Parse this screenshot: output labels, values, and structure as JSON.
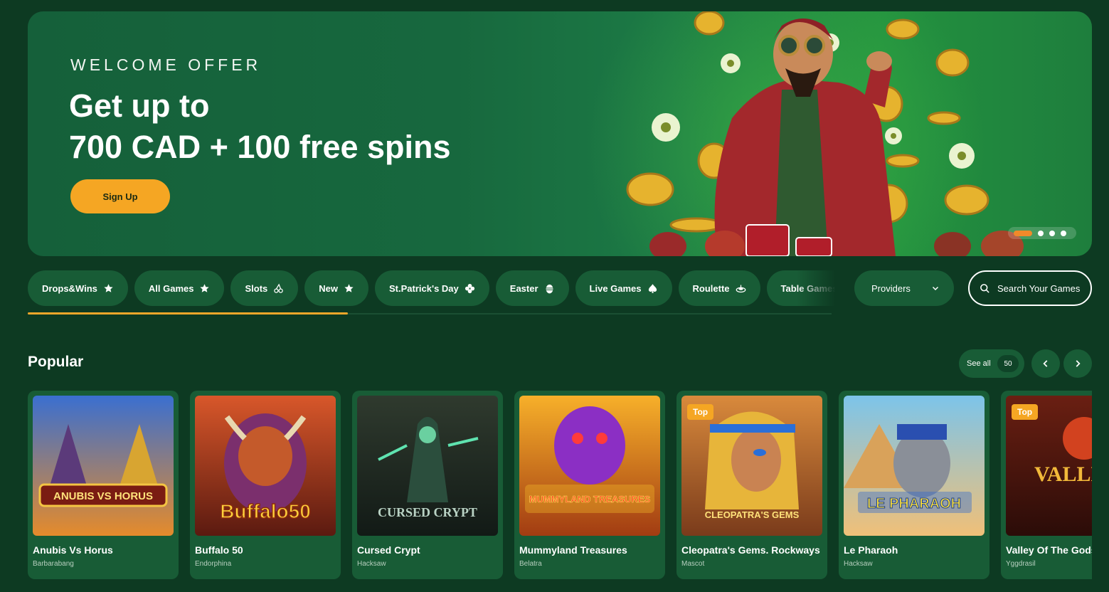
{
  "hero": {
    "kicker": "WELCOME OFFER",
    "title_line1": "Get up to",
    "title_line2": "700 CAD + 100 free spins",
    "cta": "Sign Up",
    "slides_total": 4,
    "active_slide": 1
  },
  "categories": [
    {
      "label": "Drops&Wins",
      "icon": "star-icon"
    },
    {
      "label": "All Games",
      "icon": "star-icon"
    },
    {
      "label": "Slots",
      "icon": "cherry-icon"
    },
    {
      "label": "New",
      "icon": "star-icon"
    },
    {
      "label": "St.Patrick's Day",
      "icon": "clover-icon"
    },
    {
      "label": "Easter",
      "icon": "egg-icon"
    },
    {
      "label": "Live Games",
      "icon": "spade-icon"
    },
    {
      "label": "Roulette",
      "icon": "roulette-icon"
    },
    {
      "label": "Table Games",
      "icon": "cards-icon"
    }
  ],
  "providers": {
    "label": "Providers"
  },
  "search": {
    "label": "Search Your Games"
  },
  "popular": {
    "title": "Popular",
    "see_all": "See all",
    "count": "50",
    "games": [
      {
        "name": "Anubis Vs Horus",
        "provider": "Barbarabang",
        "badge": "",
        "art": "ANUBIS VS HORUS"
      },
      {
        "name": "Buffalo 50",
        "provider": "Endorphina",
        "badge": "",
        "art": "Buffalo50"
      },
      {
        "name": "Cursed Crypt",
        "provider": "Hacksaw",
        "badge": "",
        "art": "CURSED CRYPT"
      },
      {
        "name": "Mummyland Treasures",
        "provider": "Belatra",
        "badge": "",
        "art": "MUMMYLAND TREASURES"
      },
      {
        "name": "Cleopatra's Gems. Rockways",
        "provider": "Mascot",
        "badge": "Top",
        "art": "CLEOPATRA'S GEMS"
      },
      {
        "name": "Le Pharaoh",
        "provider": "Hacksaw",
        "badge": "",
        "art": "LE PHARAOH"
      },
      {
        "name": "Valley Of The Gods",
        "provider": "Yggdrasil",
        "badge": "Top",
        "art": "VALLEY OF THE GODS"
      }
    ]
  },
  "colors": {
    "background": "#0d3a22",
    "panel": "#185c36",
    "accent": "#f5a623",
    "progress": "#f0a62a"
  }
}
